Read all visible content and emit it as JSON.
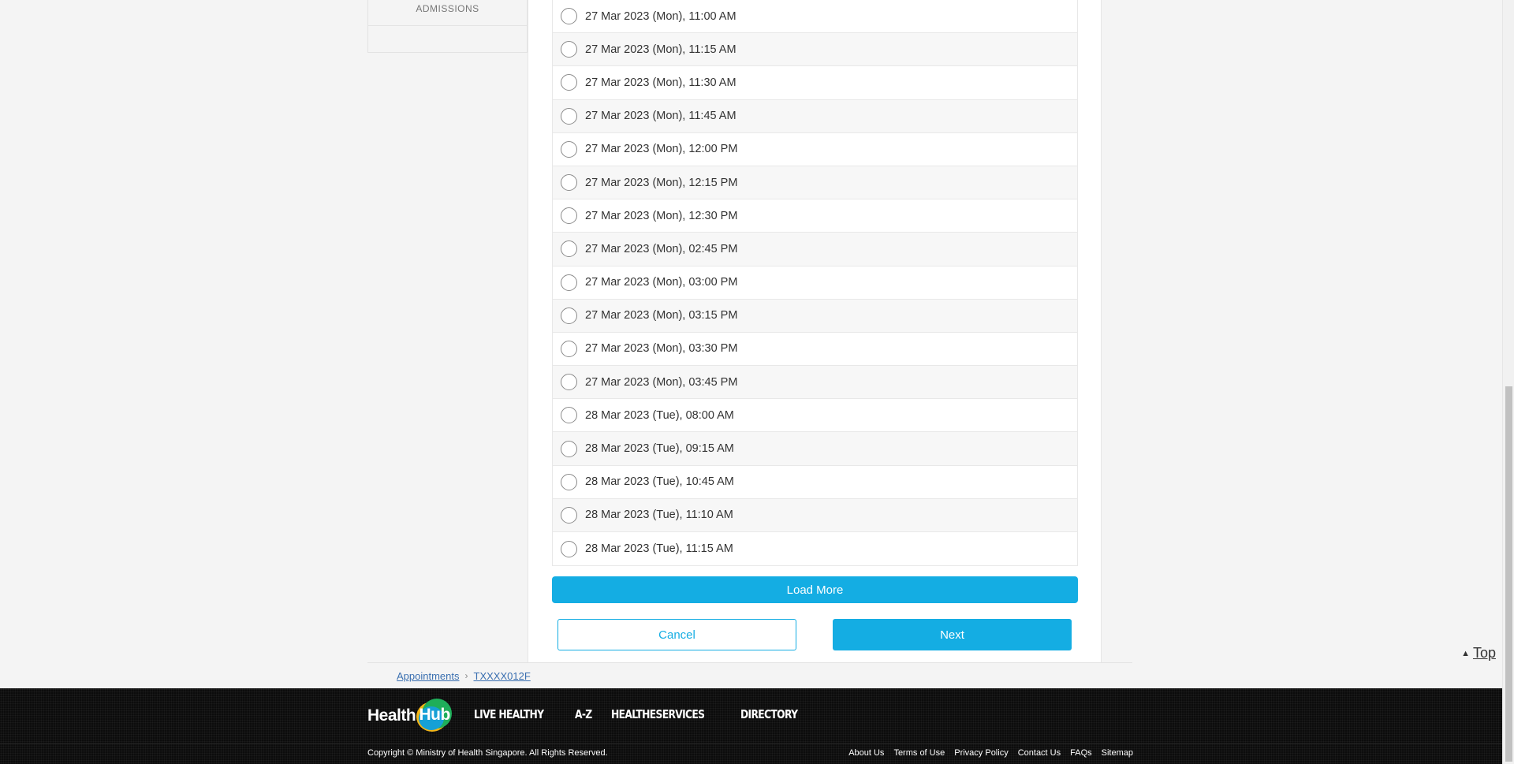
{
  "sidebar": {
    "admissions_label": "ADMISSIONS"
  },
  "slots": [
    {
      "label": "27 Mar 2023 (Mon), 11:00 AM"
    },
    {
      "label": "27 Mar 2023 (Mon), 11:15 AM"
    },
    {
      "label": "27 Mar 2023 (Mon), 11:30 AM"
    },
    {
      "label": "27 Mar 2023 (Mon), 11:45 AM"
    },
    {
      "label": "27 Mar 2023 (Mon), 12:00 PM"
    },
    {
      "label": "27 Mar 2023 (Mon), 12:15 PM"
    },
    {
      "label": "27 Mar 2023 (Mon), 12:30 PM"
    },
    {
      "label": "27 Mar 2023 (Mon), 02:45 PM"
    },
    {
      "label": "27 Mar 2023 (Mon), 03:00 PM"
    },
    {
      "label": "27 Mar 2023 (Mon), 03:15 PM"
    },
    {
      "label": "27 Mar 2023 (Mon), 03:30 PM"
    },
    {
      "label": "27 Mar 2023 (Mon), 03:45 PM"
    },
    {
      "label": "28 Mar 2023 (Tue), 08:00 AM"
    },
    {
      "label": "28 Mar 2023 (Tue), 09:15 AM"
    },
    {
      "label": "28 Mar 2023 (Tue), 10:45 AM"
    },
    {
      "label": "28 Mar 2023 (Tue), 11:10 AM"
    },
    {
      "label": "28 Mar 2023 (Tue), 11:15 AM"
    }
  ],
  "actions": {
    "load_more": "Load More",
    "cancel": "Cancel",
    "next": "Next"
  },
  "breadcrumb": {
    "items": [
      "Appointments",
      "TXXXX012F"
    ],
    "separator": "›"
  },
  "back_to_top": {
    "label": "Top",
    "icon": "triangle-up-icon"
  },
  "footer": {
    "logo_word_1": "Health",
    "logo_word_2": "Hub",
    "nav": [
      "LIVE HEALTHY",
      "A-Z",
      "HEALTHESERVICES",
      "DIRECTORY"
    ],
    "copyright": "Copyright © Ministry of Health Singapore. All Rights Reserved.",
    "links": [
      "About Us",
      "Terms of Use",
      "Privacy Policy",
      "Contact Us",
      "FAQs",
      "Sitemap"
    ]
  },
  "colors": {
    "accent": "#14ade3",
    "footer_bg": "#0c0c0c",
    "link": "#3a6fb0"
  }
}
